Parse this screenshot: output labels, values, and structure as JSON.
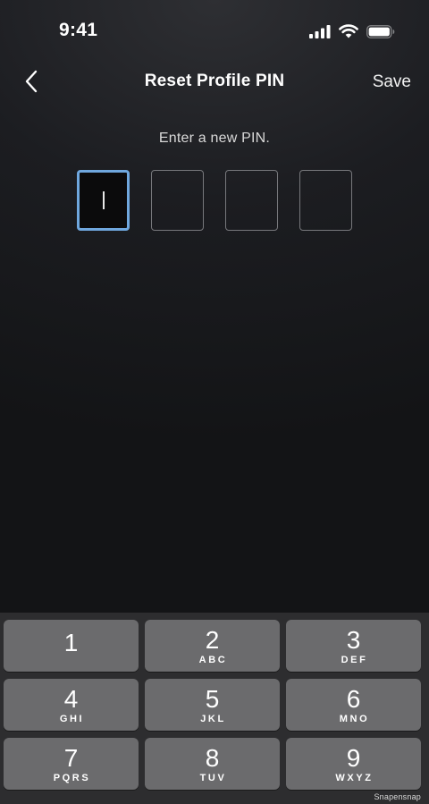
{
  "status_bar": {
    "time": "9:41",
    "icons": [
      "cellular-signal-icon",
      "wifi-icon",
      "battery-icon"
    ]
  },
  "nav": {
    "back_icon": "chevron-left-icon",
    "title": "Reset Profile PIN",
    "save_label": "Save"
  },
  "pin_entry": {
    "prompt": "Enter a new PIN.",
    "length": 4,
    "entered": 0,
    "active_index": 0,
    "accent_color": "#6fa7de"
  },
  "keypad": {
    "keys": [
      {
        "digit": "1",
        "letters": ""
      },
      {
        "digit": "2",
        "letters": "ABC"
      },
      {
        "digit": "3",
        "letters": "DEF"
      },
      {
        "digit": "4",
        "letters": "GHI"
      },
      {
        "digit": "5",
        "letters": "JKL"
      },
      {
        "digit": "6",
        "letters": "MNO"
      },
      {
        "digit": "7",
        "letters": "PQRS"
      },
      {
        "digit": "8",
        "letters": "TUV"
      },
      {
        "digit": "9",
        "letters": "WXYZ"
      }
    ]
  },
  "watermark": "Snapensnap"
}
